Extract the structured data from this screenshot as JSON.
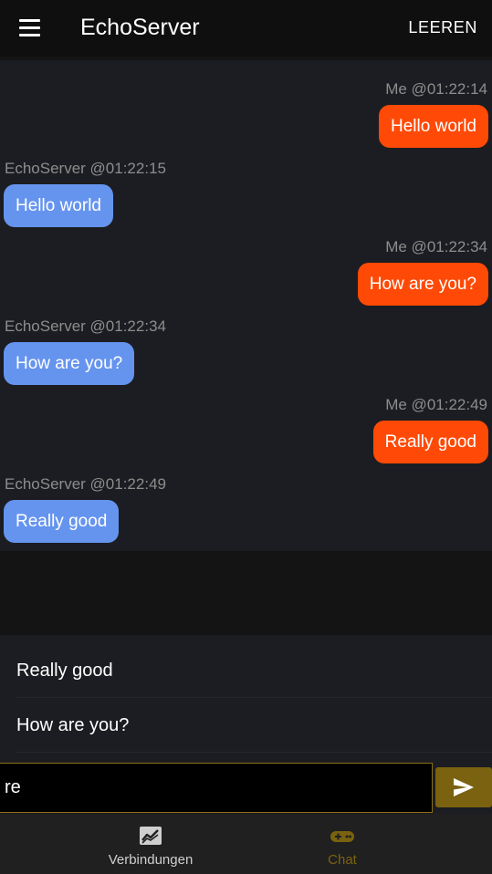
{
  "appbar": {
    "title": "EchoServer",
    "action_label": "LEEREN"
  },
  "messages": [
    {
      "from": "me",
      "meta": "Me @01:22:14",
      "text": "Hello world"
    },
    {
      "from": "them",
      "meta": "EchoServer @01:22:15",
      "text": "Hello world"
    },
    {
      "from": "me",
      "meta": "Me @01:22:34",
      "text": "How are you?"
    },
    {
      "from": "them",
      "meta": "EchoServer @01:22:34",
      "text": "How are you?"
    },
    {
      "from": "me",
      "meta": "Me @01:22:49",
      "text": "Really good"
    },
    {
      "from": "them",
      "meta": "EchoServer @01:22:49",
      "text": "Really good"
    }
  ],
  "suggestions": [
    "Really good",
    "How are you?"
  ],
  "input": {
    "value": "re",
    "placeholder": ""
  },
  "nav": [
    {
      "label": "Verbindungen",
      "icon": "chart-icon",
      "active": false
    },
    {
      "label": "Chat",
      "icon": "gamepad-icon",
      "active": true
    }
  ],
  "colors": {
    "accent": "#7a6210",
    "sent_bubble": "#ff4a07",
    "received_bubble": "#6594ef"
  }
}
